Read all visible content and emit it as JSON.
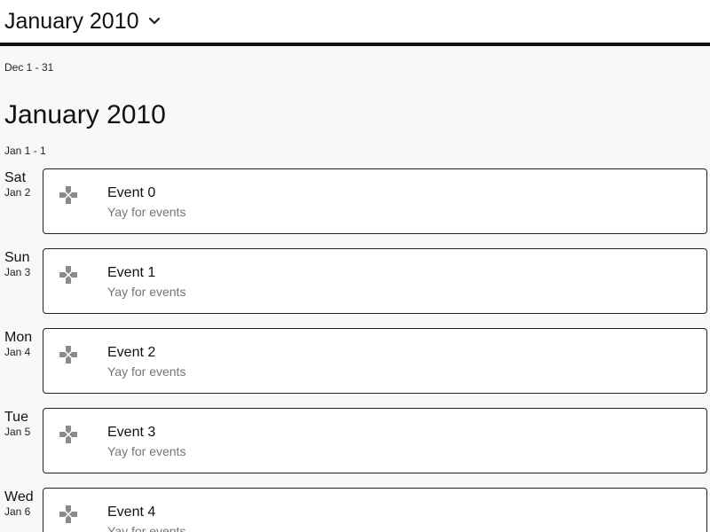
{
  "header": {
    "month_label": "January 2010",
    "chevron_icon": "chevron-down-icon"
  },
  "prev_range": "Dec 1 - 31",
  "month": {
    "heading": "January 2010",
    "range": "Jan 1 - 1"
  },
  "days": [
    {
      "dow": "Sat",
      "date": "Jan 2",
      "event": {
        "title": "Event 0",
        "subtitle": "Yay for events",
        "icon": "gamepad-icon"
      }
    },
    {
      "dow": "Sun",
      "date": "Jan 3",
      "event": {
        "title": "Event 1",
        "subtitle": "Yay for events",
        "icon": "gamepad-icon"
      }
    },
    {
      "dow": "Mon",
      "date": "Jan 4",
      "event": {
        "title": "Event 2",
        "subtitle": "Yay for events",
        "icon": "gamepad-icon"
      }
    },
    {
      "dow": "Tue",
      "date": "Jan 5",
      "event": {
        "title": "Event 3",
        "subtitle": "Yay for events",
        "icon": "gamepad-icon"
      }
    },
    {
      "dow": "Wed",
      "date": "Jan 6",
      "event": {
        "title": "Event 4",
        "subtitle": "Yay for events",
        "icon": "gamepad-icon"
      }
    }
  ],
  "colors": {
    "background": "#f8f8f8",
    "card_border": "#222222",
    "subtitle": "#757575",
    "icon": "#8a8a8a"
  }
}
